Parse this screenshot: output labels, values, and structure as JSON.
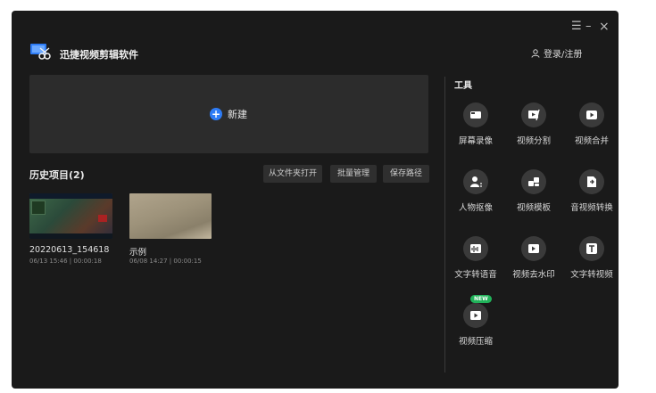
{
  "window": {
    "controls": {
      "menu": "☰",
      "minimize": "–",
      "close": "×"
    }
  },
  "app": {
    "title": "迅捷视频剪辑软件"
  },
  "account": {
    "login_label": "登录/注册"
  },
  "new_project": {
    "label": "新建"
  },
  "history": {
    "title": "历史项目(2)",
    "buttons": {
      "open_folder": "从文件夹打开",
      "batch_manage": "批量管理",
      "save_path": "保存路径"
    },
    "projects": [
      {
        "name": "20220613_154618",
        "meta": "06/13 15:46 | 00:00:18"
      },
      {
        "name": "示例",
        "meta": "06/08 14:27 | 00:00:15"
      }
    ]
  },
  "tools": {
    "title": "工具",
    "items": [
      {
        "label": "屏幕录像",
        "icon": "screen-record-icon"
      },
      {
        "label": "视频分割",
        "icon": "video-split-icon"
      },
      {
        "label": "视频合并",
        "icon": "video-merge-icon"
      },
      {
        "label": "人物抠像",
        "icon": "person-cutout-icon"
      },
      {
        "label": "视频模板",
        "icon": "video-template-icon"
      },
      {
        "label": "音视频转换",
        "icon": "av-convert-icon"
      },
      {
        "label": "文字转语音",
        "icon": "text-to-speech-icon"
      },
      {
        "label": "视频去水印",
        "icon": "remove-watermark-icon"
      },
      {
        "label": "文字转视频",
        "icon": "text-to-video-icon"
      },
      {
        "label": "视频压缩",
        "icon": "video-compress-icon",
        "badge": "NEW"
      }
    ]
  },
  "colors": {
    "window_bg": "#1a1a1a",
    "panel_bg": "#2c2c2c",
    "accent": "#2e7cf6",
    "badge": "#21b35a"
  }
}
